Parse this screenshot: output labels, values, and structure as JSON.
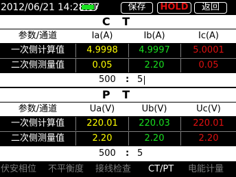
{
  "topbar": {
    "datetime": "2012/06/21 14:28:07",
    "battery_icon": "battery-full-icon",
    "battery_color": "#19e020",
    "save_label": "保存",
    "hold_label": "HOLD",
    "back_label": "返回"
  },
  "ct": {
    "title": "C T",
    "header": [
      "参数/通道",
      "Ia(A)",
      "Ib(A)",
      "Ic(A)"
    ],
    "rows": [
      {
        "label": "一次侧计算值",
        "values": [
          "4.9998",
          "4.9997",
          "5.0001"
        ]
      },
      {
        "label": "二次侧测量值",
        "values": [
          "0.05",
          "2.20",
          "0.05"
        ]
      }
    ],
    "ratio_primary": "500",
    "ratio_sep": ":",
    "ratio_secondary": "5"
  },
  "pt": {
    "title": "P T",
    "header": [
      "参数/通道",
      "Ua(V)",
      "Ub(V)",
      "Uc(V)"
    ],
    "rows": [
      {
        "label": "一次侧计算值",
        "values": [
          "220.01",
          "220.03",
          "220.01"
        ]
      },
      {
        "label": "二次侧测量值",
        "values": [
          "2.20",
          "2.20",
          "2.20"
        ]
      }
    ],
    "ratio_primary": "500",
    "ratio_sep": ":",
    "ratio_secondary": "5"
  },
  "nav": {
    "items": [
      "伏安相位",
      "不平衡度",
      "接线检查",
      "CT/PT",
      "电能计量"
    ],
    "active_index": 3
  },
  "colors": {
    "phase_a": "#ffff00",
    "phase_b": "#19e020",
    "phase_c": "#e01010"
  }
}
